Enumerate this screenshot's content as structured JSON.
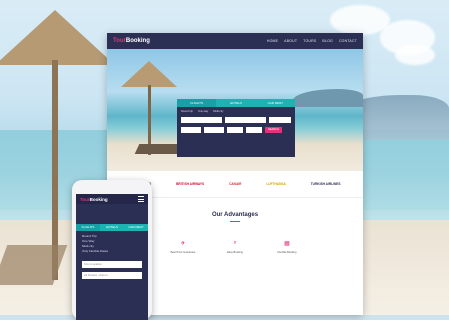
{
  "desktop": {
    "logo": {
      "accent": "Tour",
      "rest": "Booking"
    },
    "menu": [
      "HOME",
      "ABOUT",
      "TOURS",
      "BLOG",
      "CONTACT"
    ],
    "search": {
      "tabs": [
        "FLIGHTS",
        "HOTELS",
        "CAR RENT"
      ],
      "radios": [
        "Round trip",
        "One way",
        "Multi-city"
      ],
      "button": "SEARCH"
    },
    "brands": [
      "AEROMEXICO",
      "BRITISH AIRWAYS",
      "CANAIR",
      "LUFTHANSA",
      "TURKISH AIRLINES"
    ],
    "advantages": {
      "title": "Our Advantages",
      "items": [
        {
          "icon": "plane-icon",
          "text": "Best Price Guarantee"
        },
        {
          "icon": "search-icon",
          "text": "Easy Booking"
        },
        {
          "icon": "calendar-icon",
          "text": "Flexible Booking"
        }
      ]
    }
  },
  "phone": {
    "logo": {
      "accent": "Tour",
      "rest": "Booking"
    },
    "tabs": [
      "FLIGHTS",
      "HOTELS",
      "CAR RENT"
    ],
    "checks": [
      "Round Trip",
      "One Way",
      "Multi-city",
      "Only Flexible Dates"
    ],
    "fields": [
      "From Location",
      "Air Routes / Airport"
    ]
  },
  "colors": {
    "navy": "#2c2f54",
    "teal": "#1eb3b3",
    "pink": "#e0337a"
  }
}
